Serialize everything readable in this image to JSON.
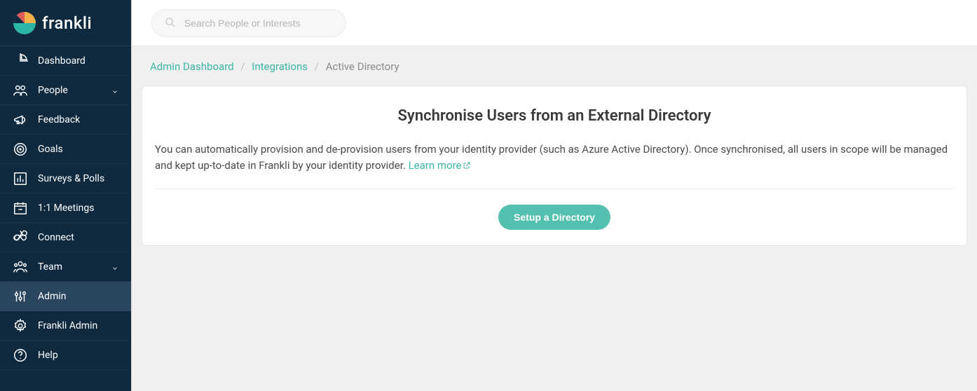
{
  "brand": {
    "name": "frankli"
  },
  "search": {
    "placeholder": "Search People or Interests"
  },
  "sidebar": {
    "items": [
      {
        "label": "Dashboard",
        "icon": "pie-chart-icon",
        "expandable": false
      },
      {
        "label": "People",
        "icon": "people-icon",
        "expandable": true
      },
      {
        "label": "Feedback",
        "icon": "megaphone-icon",
        "expandable": false
      },
      {
        "label": "Goals",
        "icon": "target-icon",
        "expandable": false
      },
      {
        "label": "Surveys & Polls",
        "icon": "bar-chart-icon",
        "expandable": false
      },
      {
        "label": "1:1 Meetings",
        "icon": "calendar-icon",
        "expandable": false
      },
      {
        "label": "Connect",
        "icon": "infinity-icon",
        "expandable": false
      },
      {
        "label": "Team",
        "icon": "group-icon",
        "expandable": true
      },
      {
        "label": "Admin",
        "icon": "sliders-icon",
        "expandable": false,
        "active": true
      },
      {
        "label": "Frankli Admin",
        "icon": "gear-icon",
        "expandable": false
      },
      {
        "label": "Help",
        "icon": "help-icon",
        "expandable": false
      }
    ]
  },
  "breadcrumb": {
    "items": [
      {
        "label": "Admin Dashboard",
        "link": true
      },
      {
        "label": "Integrations",
        "link": true
      },
      {
        "label": "Active Directory",
        "link": false
      }
    ]
  },
  "panel": {
    "title": "Synchronise Users from an External Directory",
    "body": "You can automatically provision and de-provision users from your identity provider (such as Azure Active Directory). Once synchronised, all users in scope will be managed and kept up-to-date in Frankli by your identity provider. ",
    "learn_more": "Learn more",
    "button": "Setup a Directory"
  }
}
